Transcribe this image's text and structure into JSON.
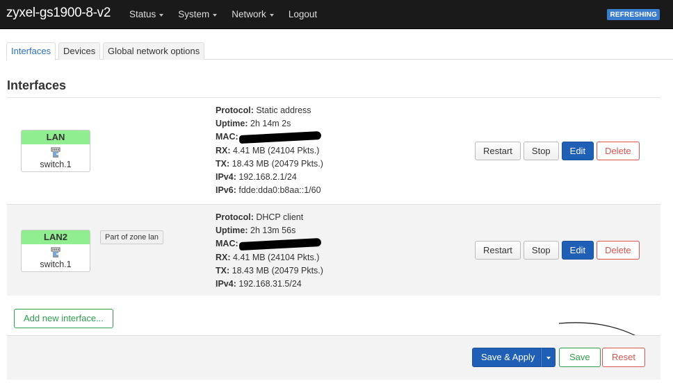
{
  "header": {
    "brand": "zyxel-gs1900-8-v2",
    "nav": [
      "Status",
      "System",
      "Network",
      "Logout"
    ],
    "badge": "REFRESHING"
  },
  "tabs": [
    "Interfaces",
    "Devices",
    "Global network options"
  ],
  "section_title": "Interfaces",
  "interfaces": [
    {
      "name": "LAN",
      "device": "switch.1",
      "zone_tip": "",
      "protocol_label": "Protocol:",
      "protocol": "Static address",
      "uptime_label": "Uptime:",
      "uptime": "2h 14m 2s",
      "mac_label": "MAC:",
      "rx_label": "RX:",
      "rx": "4.41 MB (24104 Pkts.)",
      "tx_label": "TX:",
      "tx": "18.43 MB (20479 Pkts.)",
      "ipv4_label": "IPv4:",
      "ipv4": "192.168.2.1/24",
      "ipv6_label": "IPv6:",
      "ipv6": "fdde:dda0:b8aa::1/60"
    },
    {
      "name": "LAN2",
      "device": "switch.1",
      "zone_tip": "Part of zone lan",
      "protocol_label": "Protocol:",
      "protocol": "DHCP client",
      "uptime_label": "Uptime:",
      "uptime": "2h 13m 56s",
      "mac_label": "MAC:",
      "rx_label": "RX:",
      "rx": "4.41 MB (24104 Pkts.)",
      "tx_label": "TX:",
      "tx": "18.43 MB (20479 Pkts.)",
      "ipv4_label": "IPv4:",
      "ipv4": "192.168.31.5/24"
    }
  ],
  "row_buttons": {
    "restart": "Restart",
    "stop": "Stop",
    "edit": "Edit",
    "delete": "Delete"
  },
  "add_interface": "Add new interface...",
  "footer": {
    "save_apply": "Save & Apply",
    "save": "Save",
    "reset": "Reset"
  },
  "colors": {
    "header_bg": "#1a1a1a",
    "badge": "#3b7ccf",
    "iface_name_bg": "#90ee90",
    "primary": "#1f5fb6",
    "danger": "#d9534f",
    "success": "#2e9d4e"
  }
}
